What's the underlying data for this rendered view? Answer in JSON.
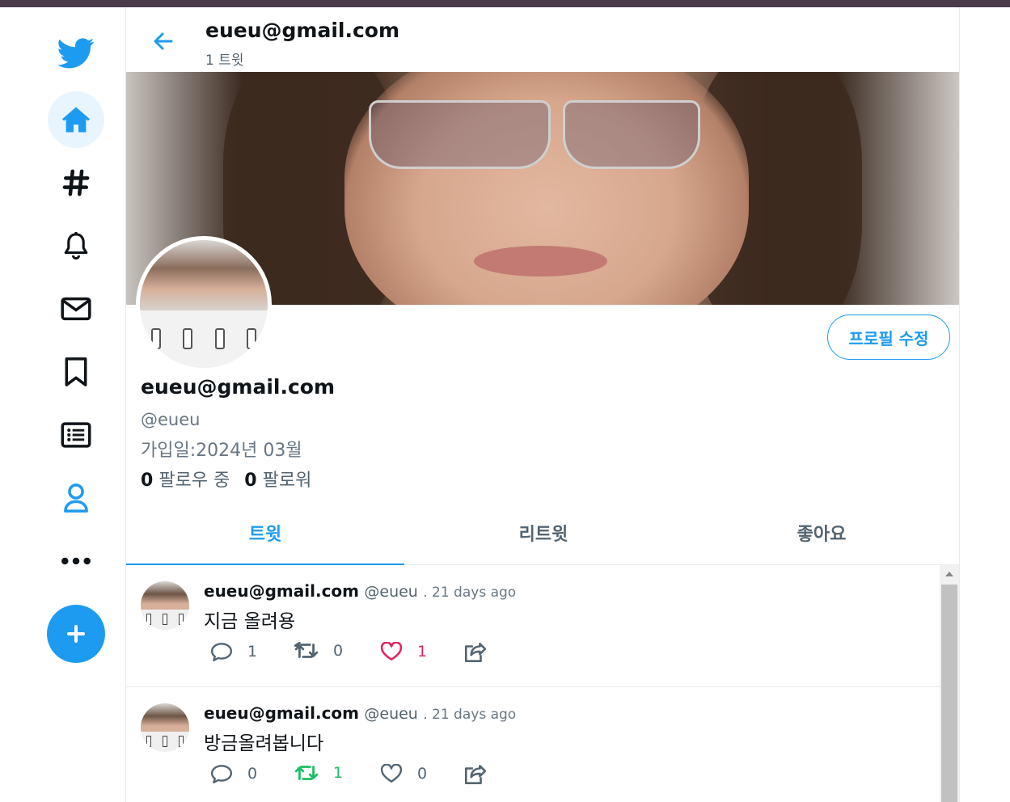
{
  "colors": {
    "accent": "#1d9bf0",
    "like": "#e0245e",
    "retweet": "#17bf63",
    "muted": "#536471"
  },
  "sidebar": {
    "items": [
      {
        "icon": "twitter-logo-icon"
      },
      {
        "icon": "home-icon",
        "active": true
      },
      {
        "icon": "hashtag-icon"
      },
      {
        "icon": "bell-icon"
      },
      {
        "icon": "mail-icon"
      },
      {
        "icon": "bookmark-icon"
      },
      {
        "icon": "list-icon"
      },
      {
        "icon": "profile-icon"
      },
      {
        "icon": "more-icon"
      }
    ],
    "tweet_button": {
      "icon": "plus-icon"
    }
  },
  "header": {
    "title": "eueu@gmail.com",
    "subtitle": "1 트윗"
  },
  "profile": {
    "name": "eueu@gmail.com",
    "handle": "@eueu",
    "joined": "가입일:2024년 03월",
    "following_count": "0",
    "following_label": "팔로우 중",
    "followers_count": "0",
    "followers_label": "팔로워",
    "edit_button": "프로필 수정"
  },
  "tabs": [
    {
      "label": "트윗",
      "active": true
    },
    {
      "label": "리트윗"
    },
    {
      "label": "좋아요"
    }
  ],
  "tweets": [
    {
      "name": "eueu@gmail.com",
      "handle": "@eueu",
      "time": ". 21 days ago",
      "text": "지금 올려용",
      "replies": "1",
      "retweets": "0",
      "likes": "1",
      "liked": true,
      "retweeted": false
    },
    {
      "name": "eueu@gmail.com",
      "handle": "@eueu",
      "time": ". 21 days ago",
      "text": "방금올려봅니다",
      "replies": "0",
      "retweets": "1",
      "likes": "0",
      "liked": false,
      "retweeted": true
    }
  ]
}
